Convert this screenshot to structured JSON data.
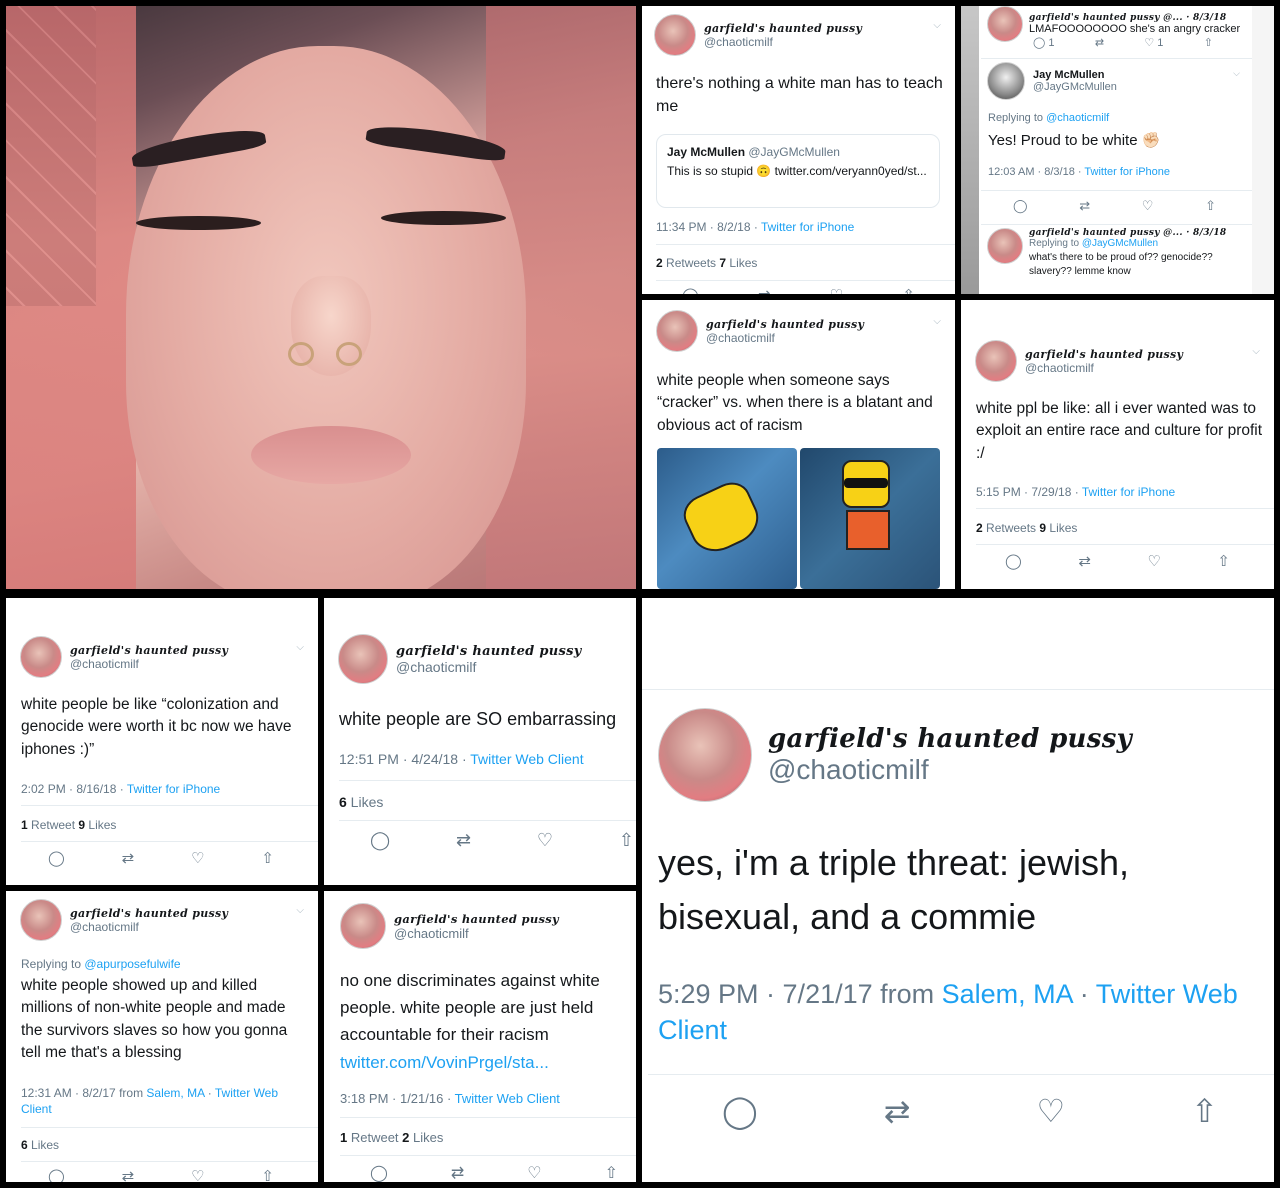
{
  "profile": {
    "display_name": "garfield's haunted pussy",
    "handle": "@chaoticmilf"
  },
  "panels": {
    "p1": {
      "text": "there's nothing a white man has to teach me",
      "quote_name": "Jay McMullen",
      "quote_handle": "@JayGMcMullen",
      "quote_text": "This is so stupid 🙃 twitter.com/veryann0yed/st...",
      "time": "11:34 PM · 8/2/18 · ",
      "source": "Twitter for iPhone",
      "retweets": "2",
      "retweets_label": " Retweets  ",
      "likes": "7",
      "likes_label": " Likes"
    },
    "p2": {
      "top_handle": "garfield's haunted pussy @... · 8/3/18",
      "top_text": "LMAFOOOOOOOO she's an angry cracker",
      "top_reply_count": "1",
      "top_like_count": "1",
      "reply_name": "Jay McMullen",
      "reply_handle": "@JayGMcMullen",
      "replying_label": "Replying to ",
      "replying_to": "@chaoticmilf",
      "reply_text": "Yes! Proud to be white ✊🏻",
      "reply_time": "12:03 AM · 8/3/18 · ",
      "reply_source": "Twitter for iPhone",
      "bottom_name": "garfield's haunted pussy @... · 8/3/18",
      "bottom_replying_label": "Replying to ",
      "bottom_replying_to": "@JayGMcMullen",
      "bottom_text": "what's there to be proud of?? genocide?? slavery?? lemme know"
    },
    "p3": {
      "text": "white people when someone says “cracker” vs. when there is a blatant and obvious act of racism"
    },
    "p4": {
      "text": "white ppl be like: all i ever wanted was to exploit an entire race and culture for profit :/",
      "time": "5:15 PM · 7/29/18 · ",
      "source": "Twitter for iPhone",
      "retweets": "2",
      "retweets_label": " Retweets  ",
      "likes": "9",
      "likes_label": " Likes"
    },
    "p5": {
      "text": "white people be like “colonization and genocide were worth it bc now we have iphones :)”",
      "time": "2:02 PM · 8/16/18 · ",
      "source": "Twitter for iPhone",
      "retweets": "1",
      "retweets_label": " Retweet  ",
      "likes": "9",
      "likes_label": " Likes"
    },
    "p6": {
      "text": "white people are SO embarrassing",
      "time": "12:51 PM · 4/24/18 · ",
      "source": "Twitter Web Client",
      "likes": "6",
      "likes_label": " Likes"
    },
    "p7": {
      "text": "yes, i'm a triple threat: jewish, bisexual, and a commie",
      "time": "5:29 PM · 7/21/17 from ",
      "location": "Salem, MA",
      "sep": " · ",
      "source": "Twitter Web Client"
    },
    "p8": {
      "replying_label": "Replying to ",
      "replying_to": "@apurposefulwife",
      "text": "white people showed up and killed millions of non-white people and made the survivors slaves so how you gonna tell me that's a blessing",
      "time": "12:31 AM · 8/2/17 from ",
      "location": "Salem, MA",
      "sep": " · ",
      "source": "Twitter Web Client",
      "likes": "6",
      "likes_label": " Likes"
    },
    "p9": {
      "text": "no one discriminates against white people. white people are just held accountable for their racism",
      "link": "twitter.com/VovinPrgel/sta...",
      "time": "3:18 PM · 1/21/16 · ",
      "source": "Twitter Web Client",
      "retweets": "1",
      "retweets_label": " Retweet  ",
      "likes": "2",
      "likes_label": " Likes"
    }
  },
  "icons": {
    "reply": "reply-icon",
    "retweet": "retweet-icon",
    "like": "heart-icon",
    "share": "share-icon",
    "chevron": "chevron-down-icon"
  },
  "colors": {
    "link": "#1da1f2",
    "meta": "#657786",
    "text": "#14171a",
    "background": "#000000"
  }
}
